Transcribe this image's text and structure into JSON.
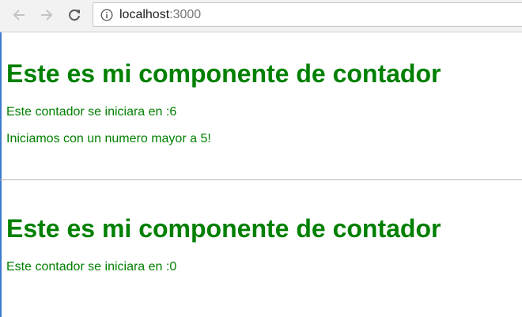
{
  "browser": {
    "url_host": "localhost",
    "url_port": ":3000",
    "icons": {
      "back": "arrow-left-icon",
      "forward": "arrow-right-icon",
      "reload": "reload-icon",
      "info": "info-icon"
    }
  },
  "components": [
    {
      "title": "Este es mi componente de contador",
      "start_text": "Este contador se iniciara en :6",
      "message": "Iniciamos con un numero mayor a 5!"
    },
    {
      "title": "Este es mi componente de contador",
      "start_text": "Este contador se iniciara en :0"
    }
  ],
  "colors": {
    "text_green": "#008000",
    "toolbar_bg": "#f2f2f2",
    "divider": "#b5b5b5"
  }
}
